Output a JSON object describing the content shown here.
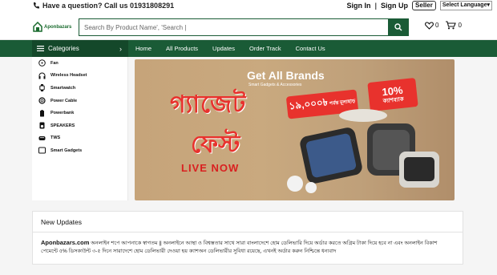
{
  "topbar": {
    "help_text": "Have a question? Call us 01931808291",
    "sign_in": "Sign In",
    "separator": "|",
    "sign_up": "Sign Up",
    "seller": "Seller",
    "language": "Select Language"
  },
  "header": {
    "logo_text": "Aponbazars",
    "search_placeholder": "Search By Product Name', 'Search |",
    "wishlist_count": "0",
    "cart_count": "0"
  },
  "nav": {
    "categories_label": "Categories",
    "categories_chevron": "›",
    "links": [
      "Home",
      "All Products",
      "Updates",
      "Order Track",
      "Contact Us"
    ]
  },
  "sidebar": {
    "items": [
      {
        "label": "Fan",
        "icon": "fan-icon"
      },
      {
        "label": "Wireless Headset",
        "icon": "headset-icon"
      },
      {
        "label": "Smartwatch",
        "icon": "watch-icon"
      },
      {
        "label": "Power Cable",
        "icon": "cable-icon"
      },
      {
        "label": "Powerbank",
        "icon": "battery-icon"
      },
      {
        "label": "SPEAKERS",
        "icon": "speaker-icon"
      },
      {
        "label": "TWS",
        "icon": "earbuds-icon"
      },
      {
        "label": "Smart Gadgets",
        "icon": "gadget-icon"
      }
    ]
  },
  "banner": {
    "title": "Get All Brands",
    "subtitle": "Smart Gadgets & Accessories",
    "fest_line1": "গ্যাজেট",
    "fest_line2": "ফেস্ট",
    "live": "LIVE NOW",
    "discount": "১৯,০০০৳",
    "discount_suffix": "পর্যন্ত মূল্যছাড়",
    "cashback_pct": "10%",
    "cashback_label": "ক্যাশব্যাক"
  },
  "updates": {
    "heading": "New Updates",
    "site": "Aponbazars.com",
    "text": " অনলাইন শপে আপনাকে স্বাগতম || অনলাইনে আস্থা ও বিশ্বস্ততার সাথে সারা বাংলাদেশে হোম ডেলিভারি দিয়ে অর্ডার করতে অগ্রিম টাকা দিয়ে হবে না এবং অনলাইন বিকাশ পেমেন্টে ৫% ডিসকাউন্ট ৩-৫ দিনে সারাদেশে হোম ডেলিভারী দেওয়া হয় ক্যাশঅন ডেলিভারীর সুবিধা রয়েছে, এখনই অর্ডার করুন নিশ্চিন্তে ধন্যবাদ"
  },
  "colors": {
    "brand_green": "#1a5b36",
    "category_green": "#14482a",
    "accent_red": "#e8322d"
  }
}
